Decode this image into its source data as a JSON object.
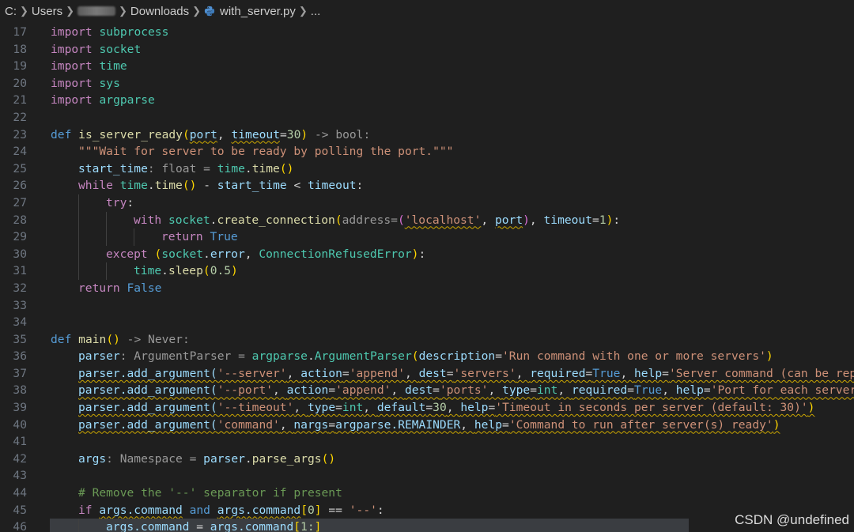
{
  "breadcrumb": {
    "drive": "C:",
    "users": "Users",
    "folder": "Downloads",
    "file": "with_server.py",
    "more": "..."
  },
  "editor": {
    "lines": [
      {
        "n": "17",
        "indent": 0,
        "tokens": [
          [
            "import",
            "k"
          ],
          [
            " ",
            ""
          ],
          [
            "subprocess",
            "t"
          ]
        ]
      },
      {
        "n": "18",
        "indent": 0,
        "tokens": [
          [
            "import",
            "k"
          ],
          [
            " ",
            ""
          ],
          [
            "socket",
            "t"
          ]
        ]
      },
      {
        "n": "19",
        "indent": 0,
        "tokens": [
          [
            "import",
            "k"
          ],
          [
            " ",
            ""
          ],
          [
            "time",
            "t"
          ]
        ]
      },
      {
        "n": "20",
        "indent": 0,
        "tokens": [
          [
            "import",
            "k"
          ],
          [
            " ",
            ""
          ],
          [
            "sys",
            "t"
          ]
        ]
      },
      {
        "n": "21",
        "indent": 0,
        "tokens": [
          [
            "import",
            "k"
          ],
          [
            " ",
            ""
          ],
          [
            "argparse",
            "t"
          ]
        ]
      },
      {
        "n": "22",
        "indent": 0,
        "tokens": []
      },
      {
        "n": "23",
        "indent": 0,
        "tokens": [
          [
            "def",
            "kw"
          ],
          [
            " ",
            ""
          ],
          [
            "is_server_ready",
            "f"
          ],
          [
            "(",
            "p1"
          ],
          [
            "port",
            "v sq"
          ],
          [
            ", ",
            "o"
          ],
          [
            "timeout",
            "v sq"
          ],
          [
            "=",
            "o"
          ],
          [
            "30",
            "n"
          ],
          [
            ")",
            "p1"
          ],
          [
            " -> bool:",
            "ty"
          ]
        ]
      },
      {
        "n": "24",
        "indent": 1,
        "tokens": [
          [
            "\"\"\"Wait for server to be ready by polling the port.\"\"\"",
            "s"
          ]
        ]
      },
      {
        "n": "25",
        "indent": 1,
        "tokens": [
          [
            "start_time",
            "v"
          ],
          [
            ": float = ",
            "ty"
          ],
          [
            "time",
            "t"
          ],
          [
            ".",
            "o"
          ],
          [
            "time",
            "f"
          ],
          [
            "()",
            "p1"
          ]
        ]
      },
      {
        "n": "26",
        "indent": 1,
        "tokens": [
          [
            "while",
            "k"
          ],
          [
            " ",
            ""
          ],
          [
            "time",
            "t"
          ],
          [
            ".",
            "o"
          ],
          [
            "time",
            "f"
          ],
          [
            "()",
            "p1"
          ],
          [
            " - ",
            "o"
          ],
          [
            "start_time",
            "v"
          ],
          [
            " < ",
            "o"
          ],
          [
            "timeout",
            "v"
          ],
          [
            ":",
            "o"
          ]
        ]
      },
      {
        "n": "27",
        "indent": 2,
        "tokens": [
          [
            "try",
            "k"
          ],
          [
            ":",
            "o"
          ]
        ]
      },
      {
        "n": "28",
        "indent": 3,
        "tokens": [
          [
            "with",
            "k"
          ],
          [
            " ",
            ""
          ],
          [
            "socket",
            "t"
          ],
          [
            ".",
            "o"
          ],
          [
            "create_connection",
            "f"
          ],
          [
            "(",
            "p1"
          ],
          [
            "address=",
            "ty"
          ],
          [
            "(",
            "p2"
          ],
          [
            "'localhost'",
            "s sq"
          ],
          [
            ", ",
            "o"
          ],
          [
            "port",
            "v sq"
          ],
          [
            ")",
            "p2"
          ],
          [
            ", ",
            "o"
          ],
          [
            "timeout",
            "v"
          ],
          [
            "=",
            "o"
          ],
          [
            "1",
            "n"
          ],
          [
            ")",
            "p1"
          ],
          [
            ":",
            "o"
          ]
        ]
      },
      {
        "n": "29",
        "indent": 4,
        "tokens": [
          [
            "return",
            "k"
          ],
          [
            " ",
            ""
          ],
          [
            "True",
            "kw"
          ]
        ]
      },
      {
        "n": "30",
        "indent": 2,
        "tokens": [
          [
            "except",
            "k"
          ],
          [
            " ",
            ""
          ],
          [
            "(",
            "p1"
          ],
          [
            "socket",
            "t"
          ],
          [
            ".",
            "o"
          ],
          [
            "error",
            "v"
          ],
          [
            ", ",
            "o"
          ],
          [
            "ConnectionRefusedError",
            "t"
          ],
          [
            ")",
            "p1"
          ],
          [
            ":",
            "o"
          ]
        ]
      },
      {
        "n": "31",
        "indent": 3,
        "tokens": [
          [
            "time",
            "t"
          ],
          [
            ".",
            "o"
          ],
          [
            "sleep",
            "f"
          ],
          [
            "(",
            "p1"
          ],
          [
            "0.5",
            "n"
          ],
          [
            ")",
            "p1"
          ]
        ]
      },
      {
        "n": "32",
        "indent": 1,
        "tokens": [
          [
            "return",
            "k"
          ],
          [
            " ",
            ""
          ],
          [
            "False",
            "kw"
          ]
        ]
      },
      {
        "n": "33",
        "indent": 0,
        "tokens": []
      },
      {
        "n": "34",
        "indent": 0,
        "tokens": []
      },
      {
        "n": "35",
        "indent": 0,
        "tokens": [
          [
            "def",
            "kw"
          ],
          [
            " ",
            ""
          ],
          [
            "main",
            "f"
          ],
          [
            "()",
            "p1"
          ],
          [
            " -> Never:",
            "ty"
          ]
        ]
      },
      {
        "n": "36",
        "indent": 1,
        "tokens": [
          [
            "parser",
            "v"
          ],
          [
            ": ArgumentParser = ",
            "ty"
          ],
          [
            "argparse",
            "t"
          ],
          [
            ".",
            "o"
          ],
          [
            "ArgumentParser",
            "t"
          ],
          [
            "(",
            "p1"
          ],
          [
            "description",
            "v"
          ],
          [
            "=",
            "o"
          ],
          [
            "'Run command with one or more servers'",
            "s"
          ],
          [
            ")",
            "p1"
          ]
        ]
      },
      {
        "n": "37",
        "indent": 1,
        "tokens": [
          [
            "parser.add_argument(",
            "v sq"
          ],
          [
            "'--server'",
            "s sq"
          ],
          [
            ", ",
            "o sq"
          ],
          [
            "action",
            "v sq"
          ],
          [
            "=",
            "o sq"
          ],
          [
            "'append'",
            "s sq"
          ],
          [
            ", ",
            "o sq"
          ],
          [
            "dest",
            "v sq"
          ],
          [
            "=",
            "o sq"
          ],
          [
            "'servers'",
            "s sq"
          ],
          [
            ", ",
            "o sq"
          ],
          [
            "required",
            "v sq"
          ],
          [
            "=",
            "o sq"
          ],
          [
            "True",
            "kw sq"
          ],
          [
            ", ",
            "o sq"
          ],
          [
            "help",
            "v sq"
          ],
          [
            "=",
            "o sq"
          ],
          [
            "'Server command (can be rep",
            "s sq"
          ]
        ]
      },
      {
        "n": "38",
        "indent": 1,
        "tokens": [
          [
            "parser.add_argument(",
            "v sq"
          ],
          [
            "'--port'",
            "s sq"
          ],
          [
            ", ",
            "o sq"
          ],
          [
            "action",
            "v sq"
          ],
          [
            "=",
            "o sq"
          ],
          [
            "'append'",
            "s sq"
          ],
          [
            ", ",
            "o sq"
          ],
          [
            "dest",
            "v sq"
          ],
          [
            "=",
            "o sq"
          ],
          [
            "'ports'",
            "s sq"
          ],
          [
            ", ",
            "o sq"
          ],
          [
            "type",
            "v sq"
          ],
          [
            "=",
            "o sq"
          ],
          [
            "int",
            "t sq"
          ],
          [
            ", ",
            "o sq"
          ],
          [
            "required",
            "v sq"
          ],
          [
            "=",
            "o sq"
          ],
          [
            "True",
            "kw sq"
          ],
          [
            ", ",
            "o sq"
          ],
          [
            "help",
            "v sq"
          ],
          [
            "=",
            "o sq"
          ],
          [
            "'Port for each server",
            "s sq"
          ]
        ]
      },
      {
        "n": "39",
        "indent": 1,
        "tokens": [
          [
            "parser.add_argument(",
            "v sq"
          ],
          [
            "'--timeout'",
            "s sq"
          ],
          [
            ", ",
            "o sq"
          ],
          [
            "type",
            "v sq"
          ],
          [
            "=",
            "o sq"
          ],
          [
            "int",
            "t sq"
          ],
          [
            ", ",
            "o sq"
          ],
          [
            "default",
            "v sq"
          ],
          [
            "=",
            "o sq"
          ],
          [
            "30",
            "n sq"
          ],
          [
            ", ",
            "o sq"
          ],
          [
            "help",
            "v sq"
          ],
          [
            "=",
            "o sq"
          ],
          [
            "'Timeout in seconds per server (default: 30)'",
            "s sq"
          ],
          [
            ")",
            "p1 sq"
          ]
        ]
      },
      {
        "n": "40",
        "indent": 1,
        "tokens": [
          [
            "parser.add_argument(",
            "v sq"
          ],
          [
            "'command'",
            "s sq"
          ],
          [
            ", ",
            "o sq"
          ],
          [
            "nargs",
            "v sq"
          ],
          [
            "=",
            "o sq"
          ],
          [
            "argparse.REMAINDER",
            "v sq"
          ],
          [
            ", ",
            "o sq"
          ],
          [
            "help",
            "v sq"
          ],
          [
            "=",
            "o sq"
          ],
          [
            "'Command to run after server(s) ready'",
            "s sq"
          ],
          [
            ")",
            "p1 sq"
          ]
        ]
      },
      {
        "n": "41",
        "indent": 0,
        "tokens": []
      },
      {
        "n": "42",
        "indent": 1,
        "tokens": [
          [
            "args",
            "v"
          ],
          [
            ": Namespace = ",
            "ty"
          ],
          [
            "parser",
            "v"
          ],
          [
            ".",
            "o"
          ],
          [
            "parse_args",
            "f"
          ],
          [
            "()",
            "p1"
          ]
        ]
      },
      {
        "n": "43",
        "indent": 0,
        "tokens": []
      },
      {
        "n": "44",
        "indent": 1,
        "tokens": [
          [
            "# Remove the '--' separator if present",
            "c"
          ]
        ]
      },
      {
        "n": "45",
        "indent": 1,
        "tokens": [
          [
            "if",
            "k"
          ],
          [
            " ",
            ""
          ],
          [
            "args.command",
            "v sq"
          ],
          [
            " ",
            "o"
          ],
          [
            "and",
            "kw"
          ],
          [
            " ",
            "o"
          ],
          [
            "args.command",
            "v sq"
          ],
          [
            "[",
            "p1"
          ],
          [
            "0",
            "n"
          ],
          [
            "]",
            "p1"
          ],
          [
            " == ",
            "o"
          ],
          [
            "'--'",
            "s"
          ],
          [
            ":",
            "o"
          ]
        ]
      },
      {
        "n": "46",
        "indent": 2,
        "highlight": true,
        "tokens": [
          [
            "args.command",
            "v"
          ],
          [
            " = ",
            "o"
          ],
          [
            "args.command",
            "v"
          ],
          [
            "[",
            "p1"
          ],
          [
            "1:",
            "n"
          ],
          [
            "]",
            "p1"
          ]
        ]
      }
    ]
  },
  "watermark": "CSDN @undefined"
}
